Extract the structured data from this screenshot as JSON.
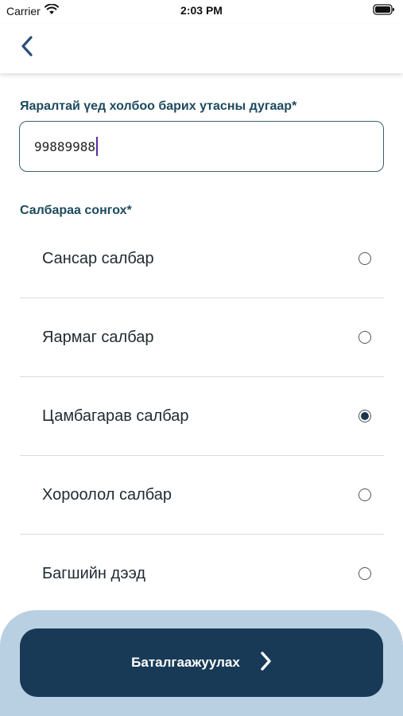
{
  "status_bar": {
    "carrier": "Carrier",
    "time": "2:03 PM",
    "wifi_icon": "wifi-icon",
    "battery_icon": "battery-icon"
  },
  "nav": {
    "back_icon": "chevron-left-icon"
  },
  "form": {
    "phone_label": "Яаралтай үед холбоо барих утасны дугаар*",
    "phone_value": "99889988",
    "branch_label": "Салбараа сонгох*"
  },
  "branches": [
    {
      "name": "Сансар салбар",
      "selected": false
    },
    {
      "name": "Яармаг салбар",
      "selected": false
    },
    {
      "name": "Цамбагарав салбар",
      "selected": true
    },
    {
      "name": "Хороолол салбар",
      "selected": false
    },
    {
      "name": "Багшийн дээд",
      "selected": false
    }
  ],
  "footer": {
    "confirm_label": "Баталгаажуулах",
    "arrow_icon": "chevron-right-icon"
  },
  "colors": {
    "primary": "#183a57",
    "label": "#1e4a5e",
    "panel": "#b9d0e2",
    "back_icon": "#2b4f78"
  }
}
